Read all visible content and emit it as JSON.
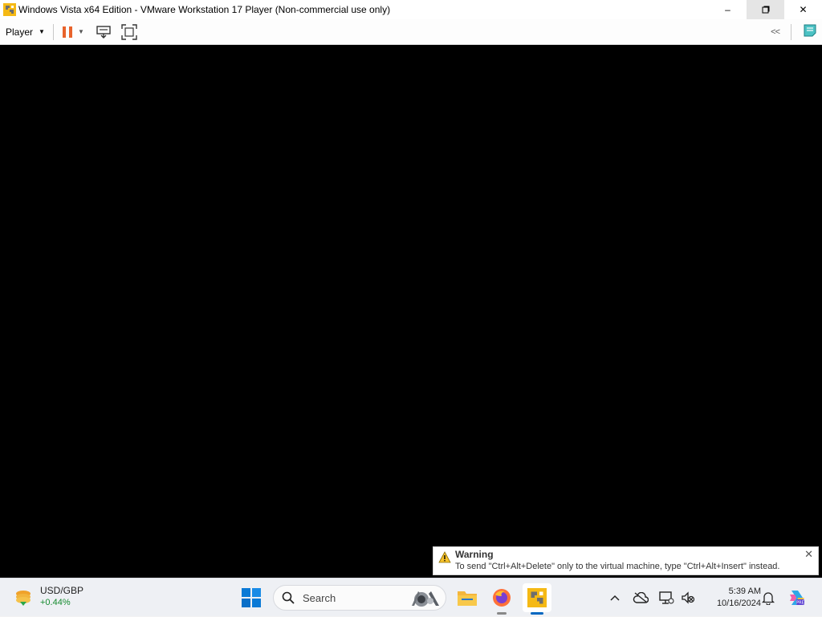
{
  "window": {
    "title": "Windows Vista x64 Edition - VMware Workstation 17 Player (Non-commercial use only)",
    "minimize_glyph": "–",
    "restore_glyph": "⧉",
    "close_glyph": "✕"
  },
  "toolbar": {
    "player_label": "Player",
    "pause_icon": "pause-icon",
    "send_cad_icon": "send-ctrl-alt-del-icon",
    "fullscreen_icon": "fullscreen-icon",
    "collapse_label": "<<",
    "notes_icon": "notes-icon"
  },
  "warning": {
    "title": "Warning",
    "message": "To send \"Ctrl+Alt+Delete\" only to the virtual machine, type \"Ctrl+Alt+Insert\" instead.",
    "close_glyph": "✕"
  },
  "taskbar": {
    "widget_title": "USD/GBP",
    "widget_value": "+0.44%",
    "search_placeholder": "Search",
    "apps": [
      "file-explorer",
      "firefox",
      "vmware-player"
    ],
    "time": "5:39 AM",
    "date": "10/16/2024"
  },
  "colors": {
    "vm_screen": "#000000",
    "accent": "#0067c0",
    "pause": "#e8632b",
    "positive": "#148a2e"
  }
}
